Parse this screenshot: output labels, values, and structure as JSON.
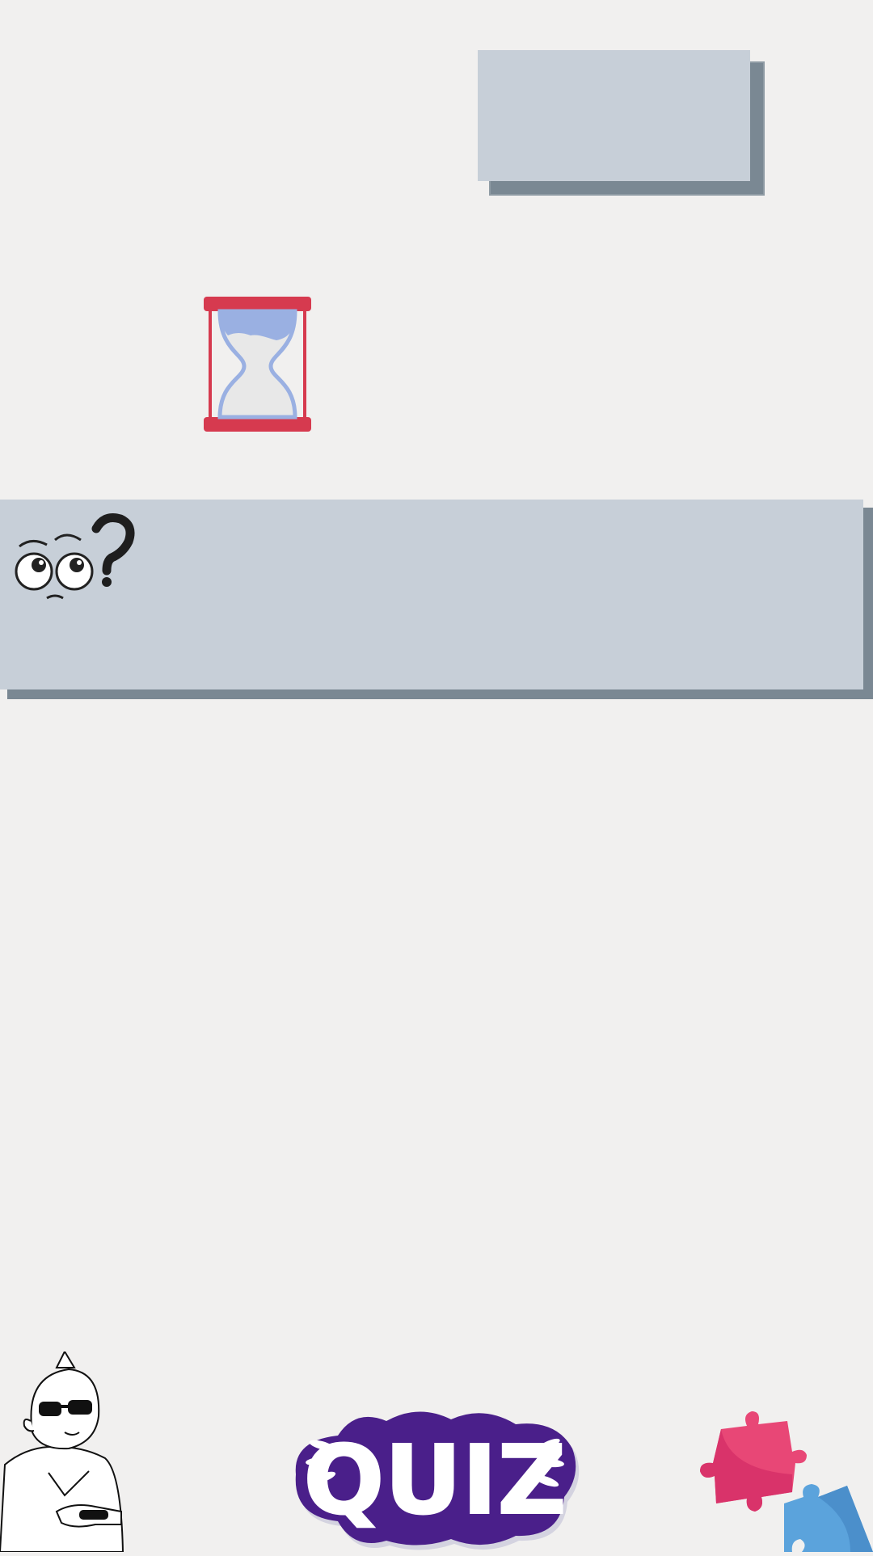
{
  "game": {
    "timer_display": "",
    "question_text": ""
  },
  "logo": {
    "text": "QUIZ"
  },
  "colors": {
    "background": "#f1f0ef",
    "panel": "#c7cfd8",
    "panel_shadow": "#7a8893",
    "hourglass_frame": "#d63a4f",
    "sand": "#9ab0e2",
    "logo_purple": "#4a1f8a",
    "puzzle_pink": "#e84776",
    "puzzle_blue": "#5ba3dc"
  },
  "icons": [
    "hourglass-icon",
    "thinking-face-icon",
    "cartoon-gamer-illustration",
    "quiz-logo",
    "puzzle-pieces-icon"
  ]
}
